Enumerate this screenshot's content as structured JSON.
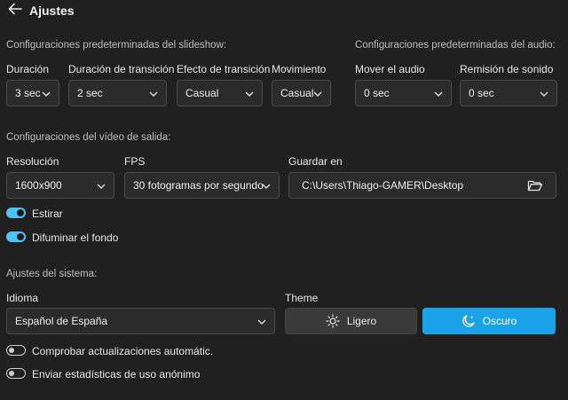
{
  "header": {
    "title": "Ajustes"
  },
  "slideshow": {
    "section_title": "Configuraciones predeterminadas del slideshow:",
    "duration": {
      "label": "Duración",
      "value": "3 sec"
    },
    "transition_duration": {
      "label": "Duración de transición",
      "value": "2 sec"
    },
    "transition_effect": {
      "label": "Efecto de transición",
      "value": "Casual"
    },
    "movement": {
      "label": "Movimiento",
      "value": "Casual"
    }
  },
  "audio": {
    "section_title": "Configuraciones predeterminadas del audio:",
    "move_audio": {
      "label": "Mover el audio",
      "value": "0 sec"
    },
    "sound_fade": {
      "label": "Remisión de sonido",
      "value": "0 sec"
    }
  },
  "output": {
    "section_title": "Configuraciones del vídeo de salida:",
    "resolution": {
      "label": "Resolución",
      "value": "1600x900"
    },
    "fps": {
      "label": "FPS",
      "value": "30 fotogramas por segundo"
    },
    "save_in": {
      "label": "Guardar en",
      "value": "C:\\Users\\Thiago-GAMER\\Desktop"
    },
    "stretch": {
      "label": "Estirar",
      "on": true
    },
    "blur_bg": {
      "label": "Difuminar el fondo",
      "on": true
    }
  },
  "system": {
    "section_title": "Ajustes del sistema:",
    "language": {
      "label": "Idioma",
      "value": "Español de España"
    },
    "theme": {
      "label": "Theme",
      "light": "Ligero",
      "dark": "Oscuro",
      "selected": "dark"
    },
    "auto_update": {
      "label": "Comprobar actualizaciones automátic.",
      "on": false
    },
    "anon_stats": {
      "label": "Enviar estadísticas de uso anónimo",
      "on": false
    }
  },
  "colors": {
    "background": "#202020",
    "accent": "#4cc2ff",
    "theme_selected": "#1aa3e8"
  },
  "icons": [
    "back-arrow-icon",
    "chevron-down-icon",
    "folder-icon",
    "sun-icon",
    "moon-icon"
  ]
}
